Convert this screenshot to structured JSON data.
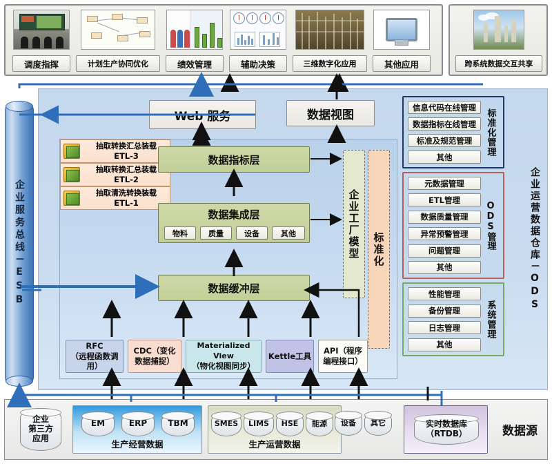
{
  "app_layer": {
    "cards": [
      {
        "label": "调度指挥",
        "icon": "control-room-icon"
      },
      {
        "label": "计划生产协同优化",
        "icon": "planning-diagram-icon"
      },
      {
        "label": "绩效管理",
        "icon": "performance-chart-icon"
      },
      {
        "label": "辅助决策",
        "icon": "decision-gauges-icon"
      },
      {
        "label": "三维数字化应用",
        "icon": "plant-3d-icon"
      },
      {
        "label": "其他应用",
        "icon": "monitor-icon"
      }
    ],
    "share_card": {
      "label": "跨系统数据交互共享",
      "icon": "refinery-photo-icon"
    }
  },
  "esb": {
    "label": "企业服务总线－ESB"
  },
  "ods": {
    "label": "企业运营数据仓库－ODS",
    "services": [
      {
        "label": "Web 服务"
      },
      {
        "label": "数据视图"
      }
    ],
    "layers": {
      "indicator": "数据指标层",
      "integration": "数据集成层",
      "integration_subs": [
        "物料",
        "质量",
        "设备",
        "其他"
      ],
      "buffer": "数据缓冲层"
    },
    "etl": [
      {
        "title": "抽取转换汇总装载",
        "code": "ETL-3"
      },
      {
        "title": "抽取转换汇总装载",
        "code": "ETL-2"
      },
      {
        "title": "抽取清洗转换装载",
        "code": "ETL-1"
      }
    ],
    "vertical_panels": [
      {
        "label": "企业工厂模型",
        "color": "#e4e8cf"
      },
      {
        "label": "标准化",
        "color": "#f8d6ba"
      }
    ],
    "connectors": [
      {
        "line1": "RFC",
        "line2": "（远程函数调用）",
        "color": "#c7d4ea"
      },
      {
        "line1": "CDC（变化",
        "line2": "数据捕捉）",
        "color": "#f9ddd0"
      },
      {
        "line1": "Materialized View",
        "line2": "（物化视图同步）",
        "color": "#c9e7ea"
      },
      {
        "line1": "Kettle工具",
        "line2": "",
        "color": "#c0c3e6"
      },
      {
        "line1": "API（程序",
        "line2": "编程接口）",
        "color": "#fbfbf7"
      }
    ],
    "management_groups": [
      {
        "title": "标准化管理",
        "title_mode": "vertical",
        "border": "#1f3864",
        "items": [
          "信息代码在线管理",
          "数据指标在线管理",
          "标准及规范管理",
          "其他"
        ]
      },
      {
        "title": "ODS管理",
        "title_mode": "mixed",
        "border": "#b0625a",
        "items": [
          "元数据管理",
          "ETL管理",
          "数据质量管理",
          "异常预警管理",
          "问题管理",
          "其他"
        ]
      },
      {
        "title": "系统管理",
        "title_mode": "vertical",
        "border": "#76a965",
        "items": [
          "性能管理",
          "备份管理",
          "日志管理",
          "其他"
        ]
      }
    ]
  },
  "data_source": {
    "title": "数据源",
    "third_party": "企业\n第三方\n应用",
    "third_party_lines": [
      "企业",
      "第三方",
      "应用"
    ],
    "groups": [
      {
        "label": "生产经营数据",
        "dbs": [
          "EM",
          "ERP",
          "TBM"
        ]
      },
      {
        "label": "生产运营数据",
        "dbs": [
          "SMES",
          "LIMS",
          "HSE",
          "能源",
          "设备",
          "其它"
        ]
      },
      {
        "label": "",
        "dbs": [
          "实时数据库\n（RTDB）"
        ],
        "rtdb_lines": [
          "实时数据库",
          "（RTDB）"
        ]
      }
    ]
  },
  "colors": {
    "arrow_blue": "#2f6fba",
    "arrow_black": "#111111",
    "panel_blue": "#c4d8ee",
    "green_layer": "#cfd9a8"
  }
}
